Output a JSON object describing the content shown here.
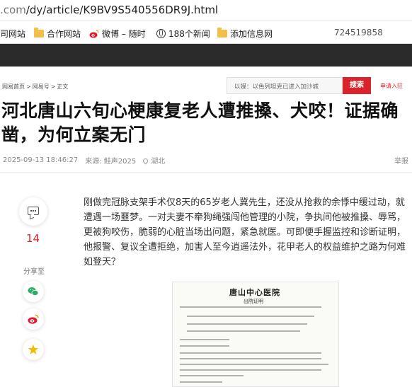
{
  "browser": {
    "url_prefix": ".com",
    "url_path": "/dy/article/K9BV9S540556DR9J.html"
  },
  "bookmarks": [
    {
      "label": "司网站",
      "icon": "none"
    },
    {
      "label": "合作网站",
      "icon": "folder-icon"
    },
    {
      "label": "微博 – 随时",
      "icon": "weibo-icon"
    },
    {
      "label": "188个新闻",
      "icon": "globe-icon"
    },
    {
      "label": "添加信息网",
      "icon": "folder-icon"
    },
    {
      "label": "724519858",
      "icon": "none"
    }
  ],
  "breadcrumb": {
    "items": [
      "网易首页",
      "网易号",
      "正文"
    ],
    "separator": ">"
  },
  "search": {
    "placeholder": "以媒：以色列坦克已进入加沙城",
    "button": "搜索"
  },
  "report_link": "申请入驻",
  "article": {
    "title": "河北唐山六旬心梗康复老人遭推搡、犬咬！证据确凿，为何立案无门",
    "date": "2025-09-13 18:46:27",
    "source": "来源: 鲑声2025",
    "location": "湖北",
    "report": "举报",
    "body": "刚做完冠脉支架手术仅8天的65岁老人冀先生，还没从抢救的余悸中缓过动，就遭遇一场噩梦。一对夫妻不牵狗绳强闯他管理的小院，争执间他被推搡、辱骂，更被狗咬伤，脆弱的心脏当场出问题，紧急就医。可即便手握监控和诊断证明，他报警、复议全遭拒绝，加害人至今逍遥法外，花甲老人的权益维护之路为何难如登天？"
  },
  "actions": {
    "comment_count": "14",
    "share_label": "分享至"
  },
  "document_image": {
    "hospital": "唐山中心医院",
    "doc_type": "出院证明"
  },
  "colors": {
    "accent": "#d9232d",
    "header_bg": "#2b2b2b"
  }
}
